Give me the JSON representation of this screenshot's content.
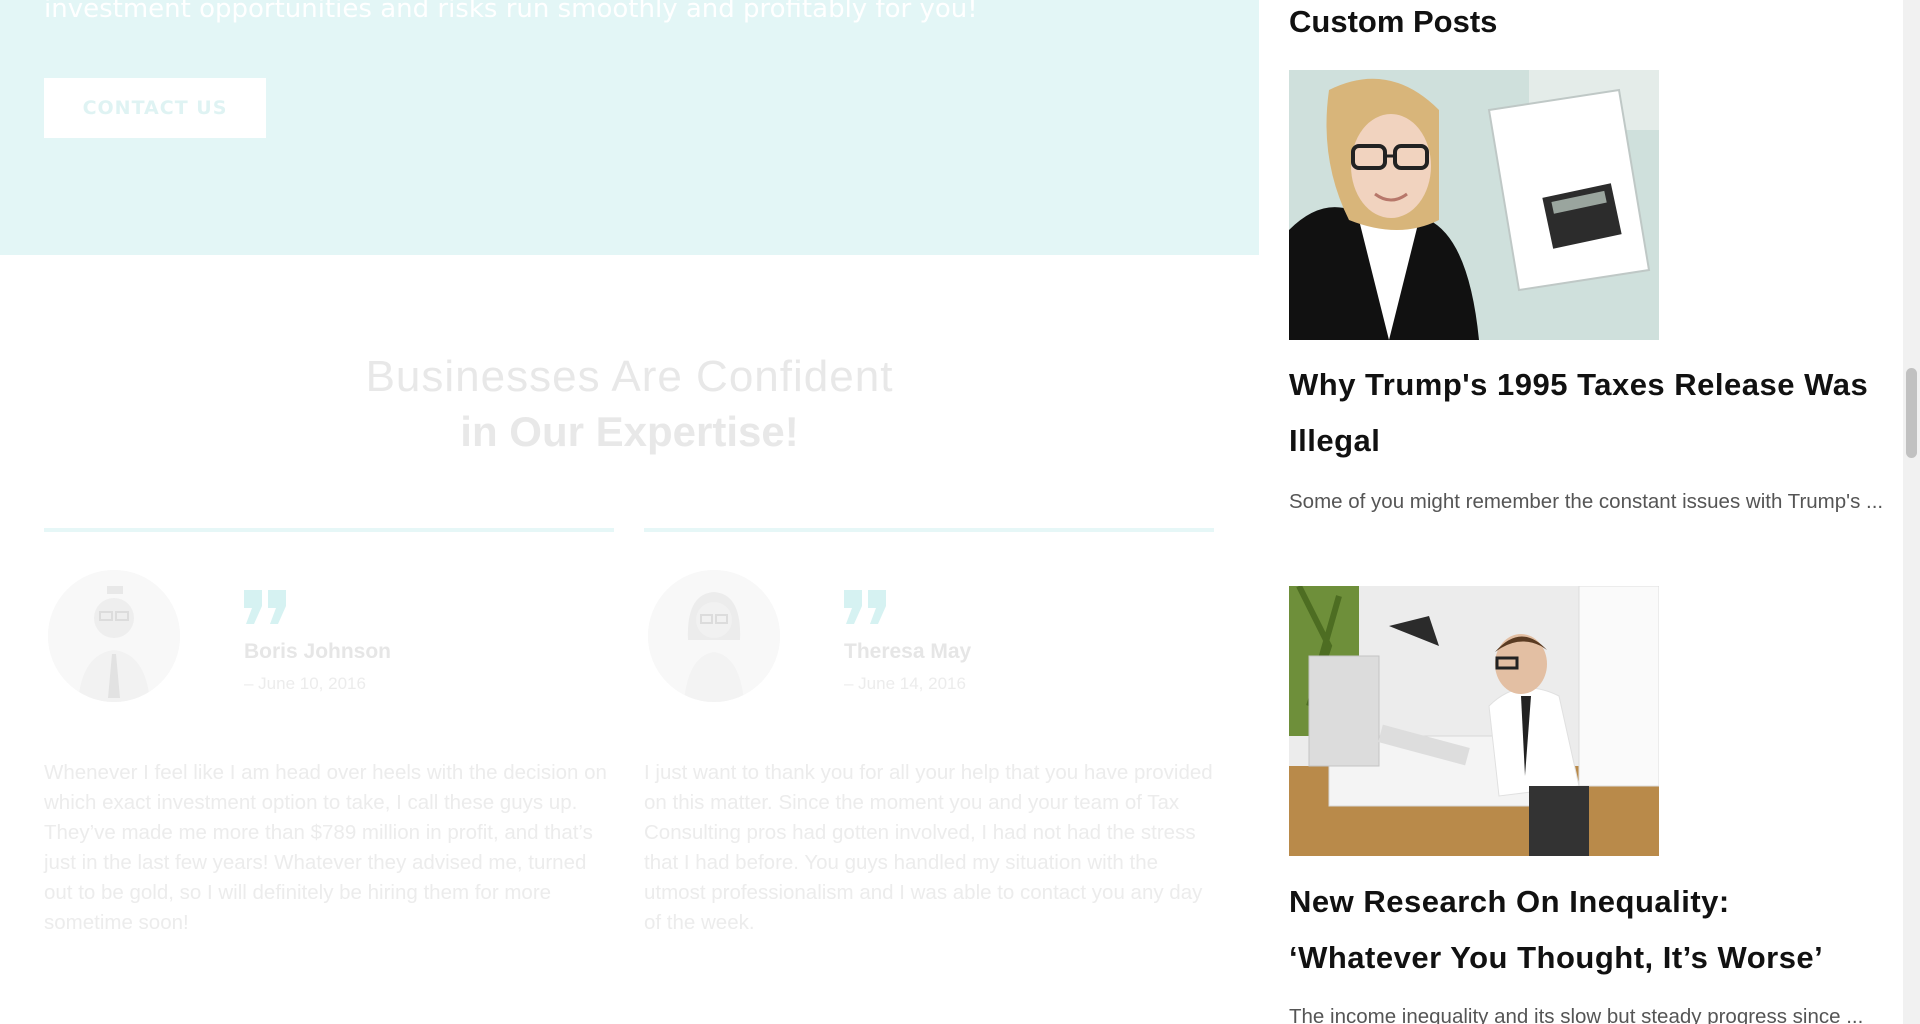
{
  "hero": {
    "text": "investment opportunities and risks run smoothly and profitably for you!",
    "contact_button": "CONTACT US"
  },
  "testimonials_section": {
    "title_line1": "Businesses Are Confident",
    "title_line2": "in Our Expertise!",
    "items": [
      {
        "author": "Boris Johnson",
        "date": "– June 10, 2016",
        "text": "Whenever I feel like I am head over heels with the decision on which exact investment option to take, I call these guys up. They’ve made me more than $789 million in profit, and that’s just in the last few years! Whatever they advised me, turned out to be gold, so I will definitely be hiring them for more sometime soon!"
      },
      {
        "author": "Theresa May",
        "date": "– June 14, 2016",
        "text": "I just want to thank you for all your help that you have provided on this matter. Since the moment you and your team of Tax Consulting  pros had gotten involved, I had not had the stress that I had before. You guys handled my situation with the utmost professionalism and I was able to contact you any day of the week."
      }
    ]
  },
  "sidebar": {
    "widget_title": "Custom Posts",
    "posts": [
      {
        "title": "Why Trump's 1995 Taxes Release Was Illegal",
        "excerpt": "Some of you might remember the constant issues with Trump's ..."
      },
      {
        "title": "New Research On Inequality: ‘Whatever You Thought, It’s Worse’",
        "excerpt": "The income inequality and its slow but steady progress since ..."
      }
    ]
  },
  "colors": {
    "hero_bg": "#e3f6f6",
    "accent": "#d6f2f2"
  }
}
